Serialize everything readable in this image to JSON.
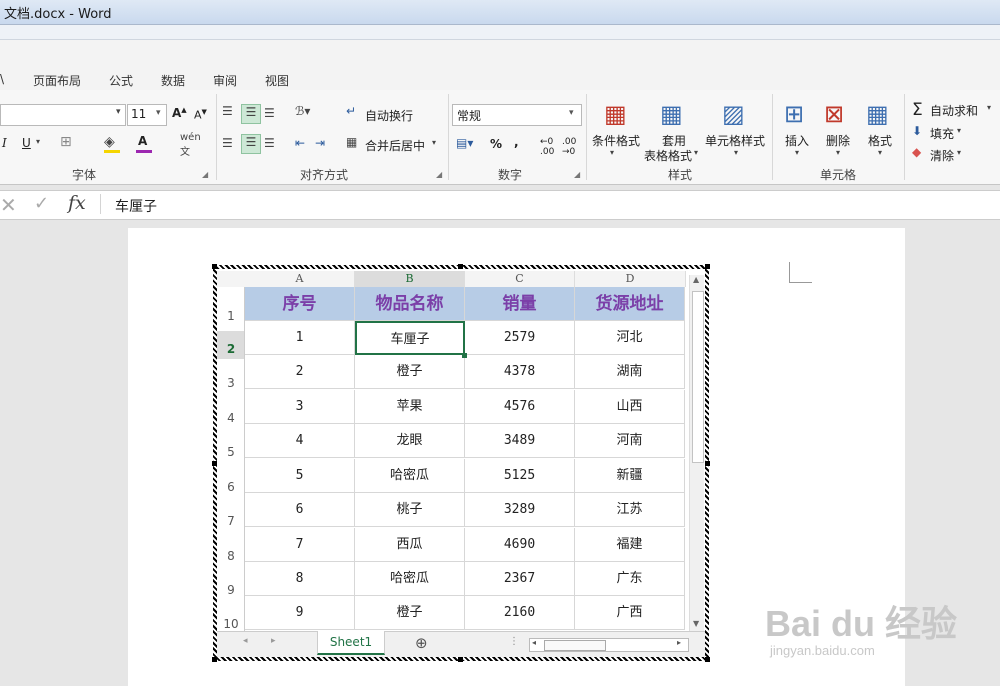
{
  "window": {
    "title": "文档.docx - Word"
  },
  "tabs": [
    "\\",
    "页面布局",
    "公式",
    "数据",
    "审阅",
    "视图"
  ],
  "ribbon": {
    "font_size": "11",
    "wrap_text": "自动换行",
    "merge_center": "合并后居中",
    "number_format": "常规",
    "cond_format": "条件格式",
    "table_format_1": "套用",
    "table_format_2": "表格格式",
    "cell_styles": "单元格样式",
    "insert": "插入",
    "delete": "删除",
    "format": "格式",
    "autosum": "自动求和",
    "fill": "填充",
    "clear": "清除",
    "groups": {
      "font": "字体",
      "align": "对齐方式",
      "number": "数字",
      "styles": "样式",
      "cells": "单元格"
    }
  },
  "formula_bar": {
    "value": "车厘子"
  },
  "sheet": {
    "columns": [
      "A",
      "B",
      "C",
      "D"
    ],
    "rows": [
      "1",
      "2",
      "3",
      "4",
      "5",
      "6",
      "7",
      "8",
      "9",
      "10"
    ],
    "header": [
      "序号",
      "物品名称",
      "销量",
      "货源地址"
    ],
    "data": [
      [
        "1",
        "车厘子",
        "2579",
        "河北"
      ],
      [
        "2",
        "橙子",
        "4378",
        "湖南"
      ],
      [
        "3",
        "苹果",
        "4576",
        "山西"
      ],
      [
        "4",
        "龙眼",
        "3489",
        "河南"
      ],
      [
        "5",
        "哈密瓜",
        "5125",
        "新疆"
      ],
      [
        "6",
        "桃子",
        "3289",
        "江苏"
      ],
      [
        "7",
        "西瓜",
        "4690",
        "福建"
      ],
      [
        "8",
        "哈密瓜",
        "2367",
        "广东"
      ],
      [
        "9",
        "橙子",
        "2160",
        "广西"
      ]
    ],
    "tab_name": "Sheet1",
    "active_cell": "B2"
  },
  "watermark": {
    "brand": "Bai du 经验",
    "url": "jingyan.baidu.com"
  }
}
